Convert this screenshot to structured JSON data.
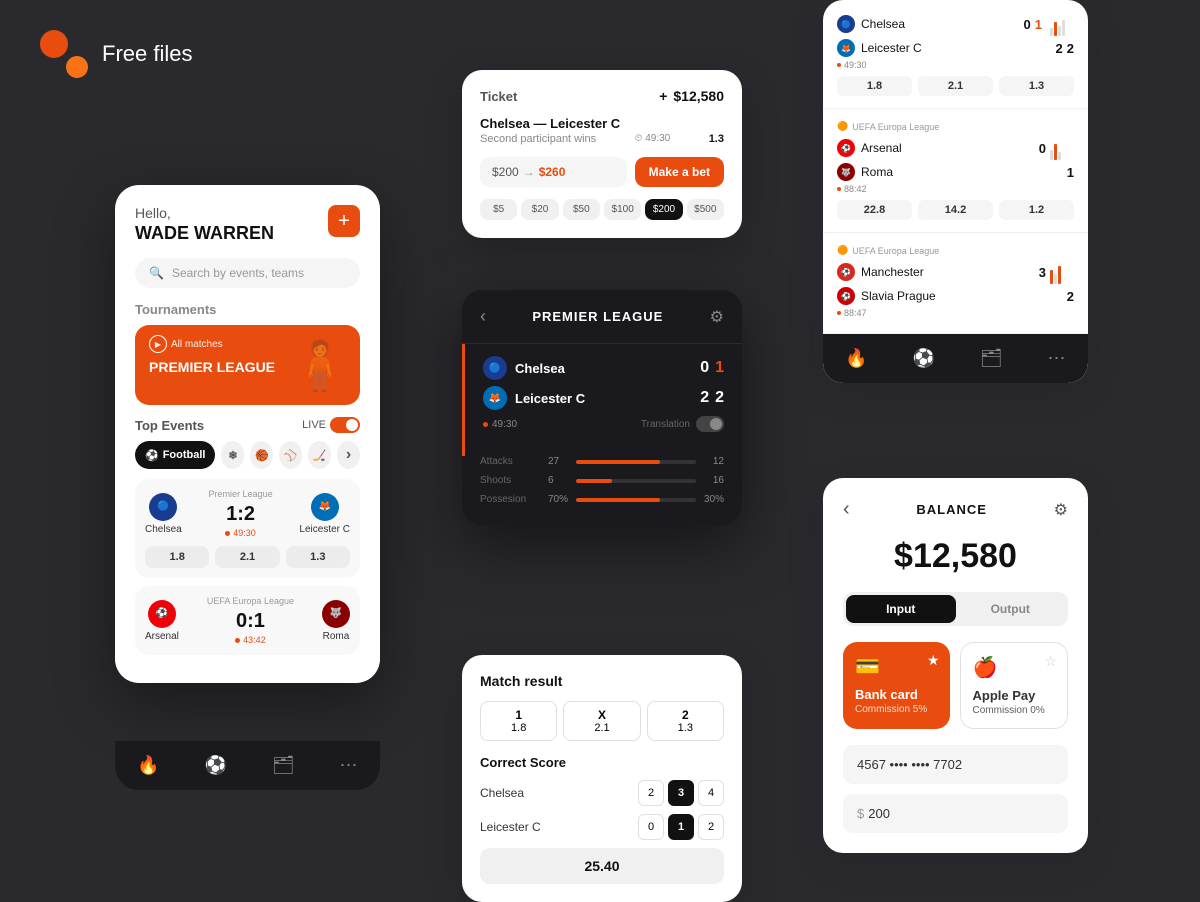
{
  "header": {
    "title": "Free files",
    "logo_alt": "Figma logo"
  },
  "card_left": {
    "greeting": "Hello,",
    "username": "WADE WARREN",
    "search_placeholder": "Search by events, teams",
    "add_btn": "+",
    "tournaments_label": "Tournaments",
    "tournament_name": "PREMIER LEAGUE",
    "tournament_all_matches": "All matches",
    "top_events_label": "Top Events",
    "live_label": "LIVE",
    "sport_tabs": [
      {
        "label": "Football",
        "active": true
      },
      {
        "icon": "❄",
        "active": false
      },
      {
        "icon": "🏀",
        "active": false
      },
      {
        "icon": "⚾",
        "active": false
      },
      {
        "icon": "🏒",
        "active": false
      },
      {
        "icon": "›",
        "active": false
      }
    ],
    "matches": [
      {
        "league": "Premier League",
        "team1": "Chelsea",
        "team2": "Leicester C",
        "score": "1:2",
        "time": "49:30",
        "odds": [
          "1.8",
          "2.1",
          "1.3"
        ]
      },
      {
        "league": "UEFA Europa League",
        "team1": "Arsenal",
        "team2": "Roma",
        "score": "0:1",
        "time": "43:42",
        "odds": []
      }
    ],
    "nav": [
      "🔥",
      "⚽",
      "🗂",
      "⋯"
    ]
  },
  "card_ticket": {
    "label": "Ticket",
    "amount": "$12,580",
    "add_icon": "+",
    "match": "Chelsea — Leicester C",
    "desc": "Second participant wins",
    "score": "1.3",
    "time": "49:30",
    "input_from": "$200",
    "input_to": "$260",
    "make_bet": "Make a bet",
    "chips": [
      "$5",
      "$20",
      "$50",
      "$100",
      "$200",
      "$500"
    ],
    "active_chip": "$200"
  },
  "card_premier": {
    "league": "PREMIER LEAGUE",
    "match": {
      "team1": "Chelsea",
      "team2": "Leicester C",
      "score1_1": "0",
      "score1_2": "1",
      "score2_1": "2",
      "score2_2": "2",
      "time": "49:30",
      "translation": "Translation"
    },
    "stats": [
      {
        "label": "Attacks",
        "val1": 27,
        "val2": 12,
        "pct": 70
      },
      {
        "label": "Shoots",
        "val1": 6,
        "val2": 16,
        "pct": 30
      },
      {
        "label": "Possesion",
        "val1": "70%",
        "val2": "30%",
        "pct": 70
      }
    ]
  },
  "card_match_result": {
    "title": "Match result",
    "chips": [
      {
        "label": "1",
        "val": "1.8"
      },
      {
        "label": "X",
        "val": "2.1"
      },
      {
        "label": "2",
        "val": "1.3"
      }
    ],
    "correct_score_title": "Correct Score",
    "teams": [
      {
        "name": "Chelsea",
        "options": [
          "2",
          "3",
          "4"
        ],
        "active": "3"
      },
      {
        "name": "Leicester C",
        "options": [
          "0",
          "1",
          "2"
        ],
        "active": "1"
      }
    ],
    "total": "25.40"
  },
  "card_live": {
    "matches": [
      {
        "league_logo": "🔵",
        "league": "",
        "team1": "Chelsea",
        "team2": "Leicester C",
        "score1": "0",
        "score2": "1",
        "score1b": "2",
        "score2b": "2",
        "time": "49:30",
        "odds": [
          "1.8",
          "2.1",
          "1.3"
        ]
      },
      {
        "league": "UEFA Europa League",
        "league_logo": "🟠",
        "team1": "Arsenal",
        "team2": "Roma",
        "score1": "0",
        "score2": "1",
        "time": "88:42",
        "odds": [
          "22.8",
          "14.2",
          "1.2"
        ]
      },
      {
        "league": "UEFA Europa League",
        "league_logo": "🟠",
        "team1": "Manchester",
        "team2": "Slavia Prague",
        "score1": "3",
        "score2": "2",
        "time": "88:47",
        "odds": []
      }
    ]
  },
  "card_balance": {
    "title": "BALANCE",
    "amount": "$12,580",
    "tabs": [
      "Input",
      "Output"
    ],
    "active_tab": "Input",
    "payment_methods": [
      {
        "name": "Bank card",
        "commission": "Commission 5%",
        "icon": "💳",
        "active": true,
        "starred": true
      },
      {
        "name": "Apple Pay",
        "commission": "Commission 0%",
        "icon": "🍎",
        "active": false,
        "starred": false
      }
    ],
    "card_number": "4567 •••• •••• 7702",
    "amount_field": "$ 200",
    "back_icon": "‹",
    "gear_icon": "⚙"
  }
}
